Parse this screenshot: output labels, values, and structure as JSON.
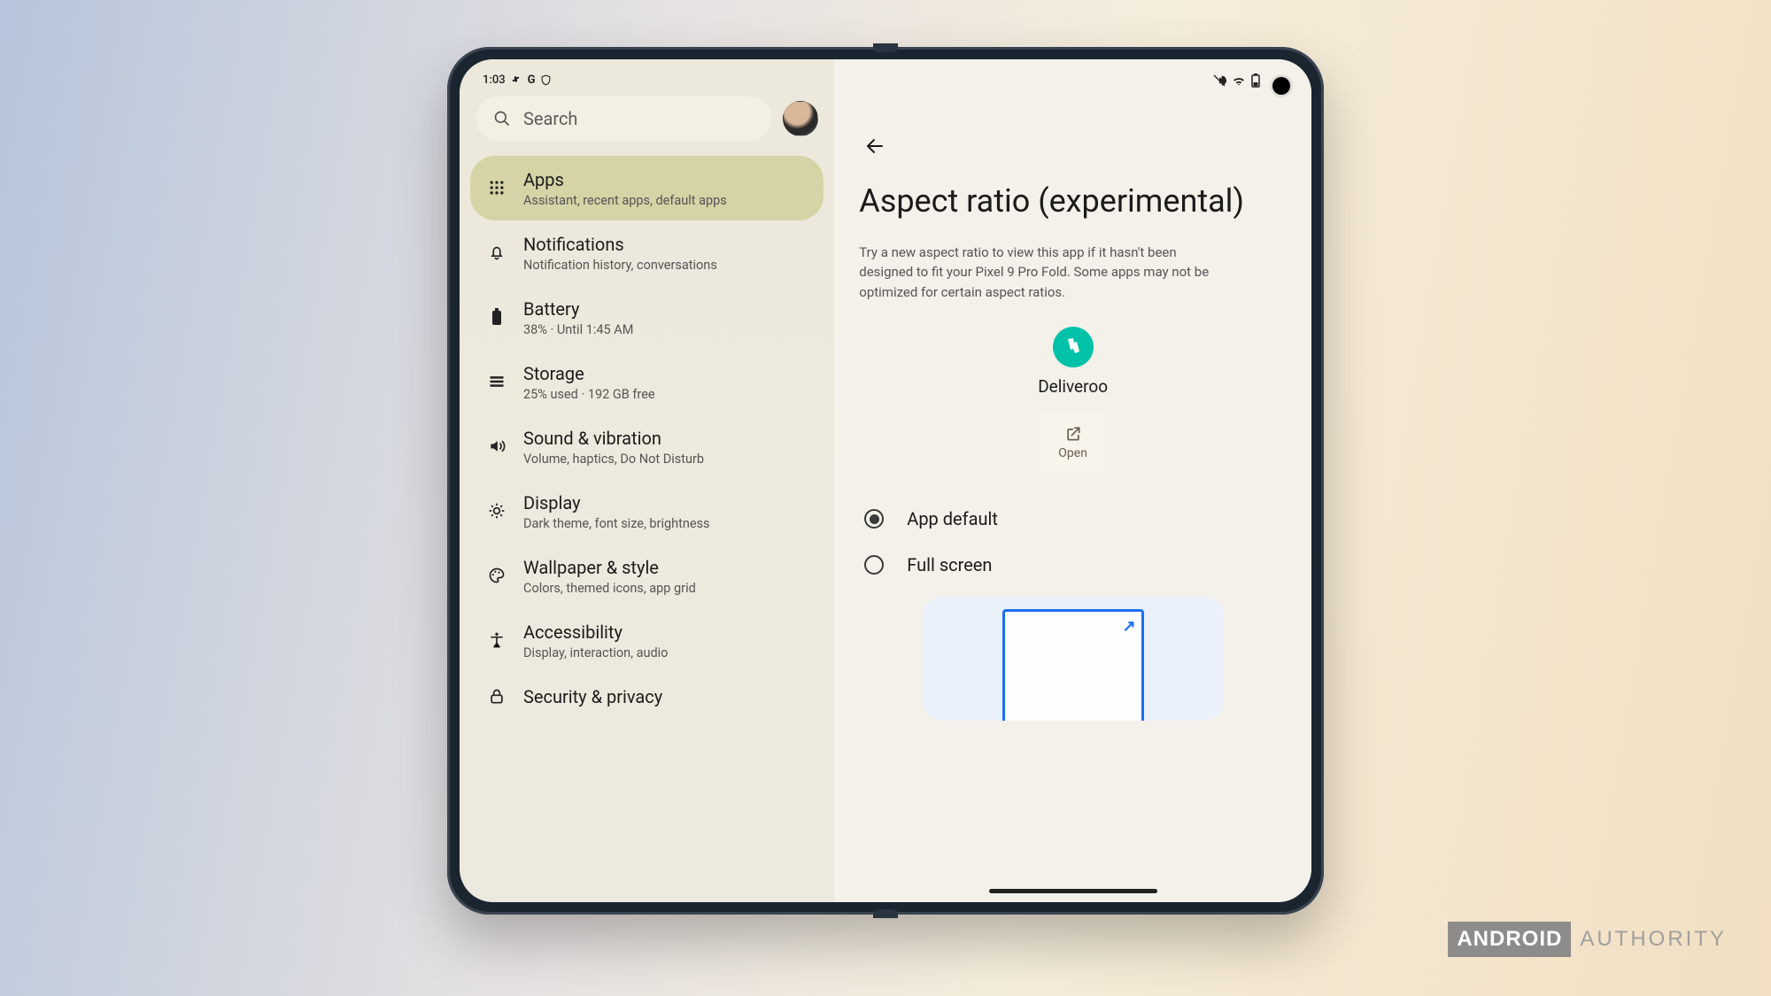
{
  "status": {
    "time": "1:03",
    "left_icons": [
      "slack-icon",
      "google-icon",
      "shield-icon"
    ],
    "right_icons": [
      "vibrate-icon",
      "wifi-icon",
      "battery-icon"
    ]
  },
  "search": {
    "placeholder": "Search"
  },
  "sidebar": {
    "items": [
      {
        "title": "Apps",
        "subtitle": "Assistant, recent apps, default apps",
        "icon": "apps-icon",
        "active": true
      },
      {
        "title": "Notifications",
        "subtitle": "Notification history, conversations",
        "icon": "bell-icon",
        "active": false
      },
      {
        "title": "Battery",
        "subtitle": "38% · Until 1:45 AM",
        "icon": "battery-icon",
        "active": false
      },
      {
        "title": "Storage",
        "subtitle": "25% used · 192 GB free",
        "icon": "storage-icon",
        "active": false
      },
      {
        "title": "Sound & vibration",
        "subtitle": "Volume, haptics, Do Not Disturb",
        "icon": "sound-icon",
        "active": false
      },
      {
        "title": "Display",
        "subtitle": "Dark theme, font size, brightness",
        "icon": "brightness-icon",
        "active": false
      },
      {
        "title": "Wallpaper & style",
        "subtitle": "Colors, themed icons, app grid",
        "icon": "palette-icon",
        "active": false
      },
      {
        "title": "Accessibility",
        "subtitle": "Display, interaction, audio",
        "icon": "accessibility-icon",
        "active": false
      },
      {
        "title": "Security & privacy",
        "subtitle": "",
        "icon": "lock-icon",
        "active": false
      }
    ]
  },
  "detail": {
    "title": "Aspect ratio (experimental)",
    "description": "Try a new aspect ratio to view this app if it hasn't been designed to fit your Pixel 9 Pro Fold. Some apps may not be optimized for certain aspect ratios.",
    "app_name": "Deliveroo",
    "open_label": "Open",
    "options": [
      {
        "label": "App default",
        "selected": true
      },
      {
        "label": "Full screen",
        "selected": false
      }
    ]
  },
  "watermark": {
    "brand": "ANDROID",
    "word": "AUTHORITY"
  }
}
